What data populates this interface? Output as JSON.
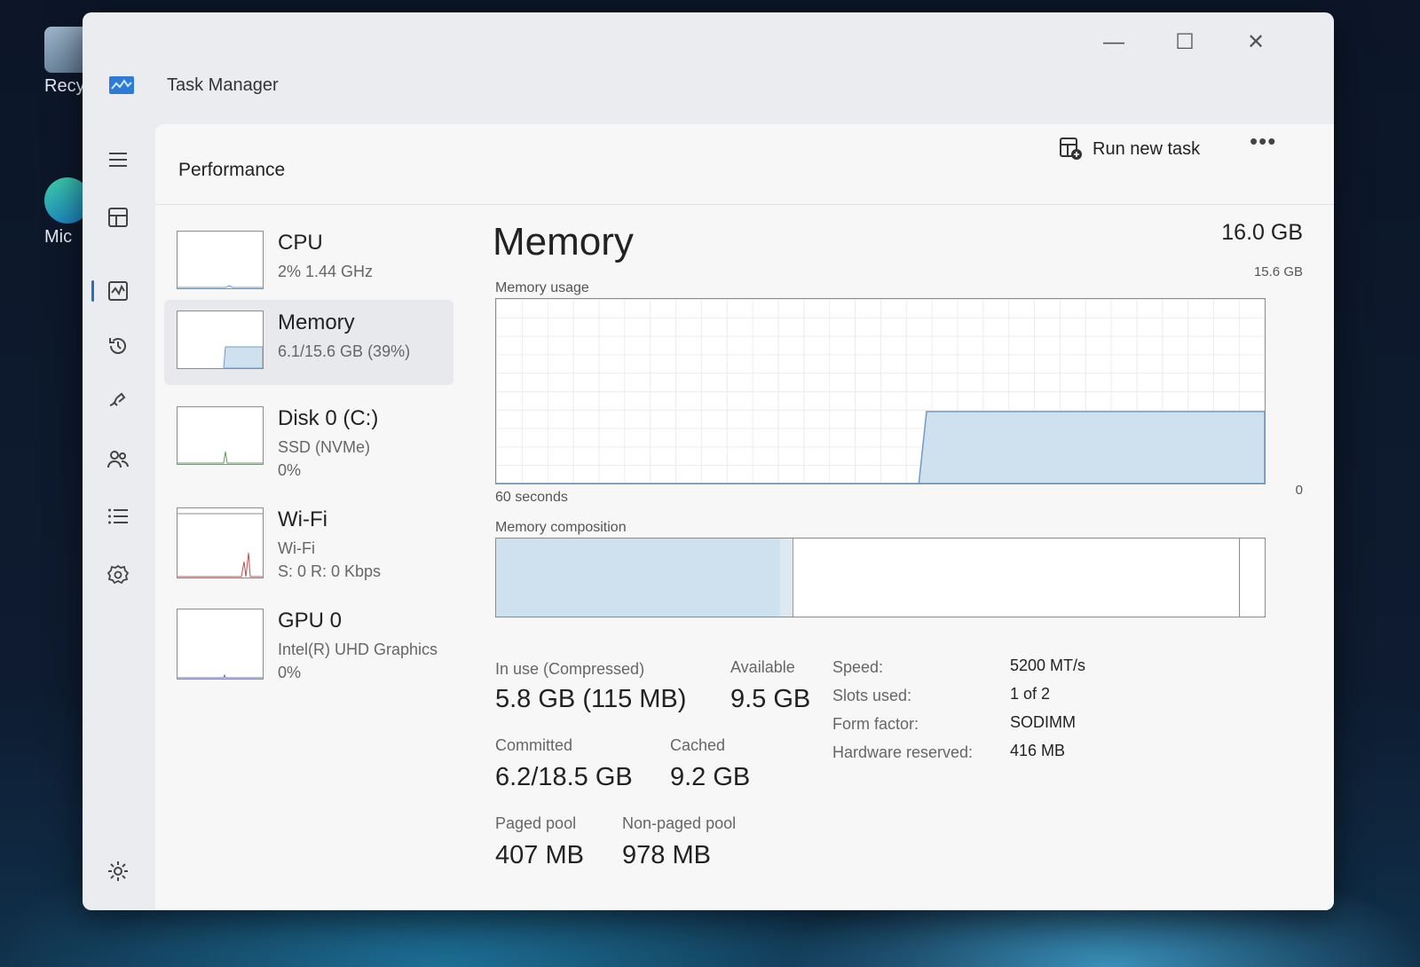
{
  "desktop": {
    "icons": [
      {
        "label": "Recy"
      },
      {
        "label": "Mic"
      }
    ]
  },
  "window": {
    "title": "Task Manager",
    "controls": {
      "minimize": "—",
      "maximize": "☐",
      "close": "✕"
    }
  },
  "toolbar": {
    "page_title": "Performance",
    "run_new_task": "Run new task",
    "more": "•••"
  },
  "devices": [
    {
      "name": "CPU",
      "sub": [
        "2% 1.44 GHz"
      ],
      "selected": false
    },
    {
      "name": "Memory",
      "sub": [
        "6.1/15.6 GB (39%)"
      ],
      "selected": true
    },
    {
      "name": "Disk 0 (C:)",
      "sub": [
        "SSD (NVMe)",
        "0%"
      ],
      "selected": false
    },
    {
      "name": "Wi-Fi",
      "sub": [
        "Wi-Fi",
        "S: 0 R: 0 Kbps"
      ],
      "selected": false
    },
    {
      "name": "GPU 0",
      "sub": [
        "Intel(R) UHD Graphics",
        "0%"
      ],
      "selected": false
    }
  ],
  "memory": {
    "title": "Memory",
    "total": "16.0 GB",
    "usage_label": "Memory usage",
    "usage_max": "15.6 GB",
    "axis_left": "60 seconds",
    "axis_right": "0",
    "composition_label": "Memory composition",
    "composition": {
      "in_use_fraction": 0.37,
      "modified_fraction": 0.016,
      "standby_fraction": 0.58
    },
    "usage_history": {
      "x_seconds_ago": [
        60,
        27,
        26.4,
        0
      ],
      "y_fraction": [
        0,
        0,
        0.39,
        0.39
      ]
    },
    "colors": {
      "fill": "#cfe0ef",
      "stroke": "#6f9cc6"
    },
    "stats": {
      "in_use_label": "In use (Compressed)",
      "in_use_value": "5.8 GB (115 MB)",
      "available_label": "Available",
      "available_value": "9.5 GB",
      "committed_label": "Committed",
      "committed_value": "6.2/18.5 GB",
      "cached_label": "Cached",
      "cached_value": "9.2 GB",
      "paged_label": "Paged pool",
      "paged_value": "407 MB",
      "nonpaged_label": "Non-paged pool",
      "nonpaged_value": "978 MB"
    },
    "specs": [
      {
        "key": "Speed:",
        "value": "5200 MT/s"
      },
      {
        "key": "Slots used:",
        "value": "1 of 2"
      },
      {
        "key": "Form factor:",
        "value": "SODIMM"
      },
      {
        "key": "Hardware reserved:",
        "value": "416 MB"
      }
    ]
  }
}
